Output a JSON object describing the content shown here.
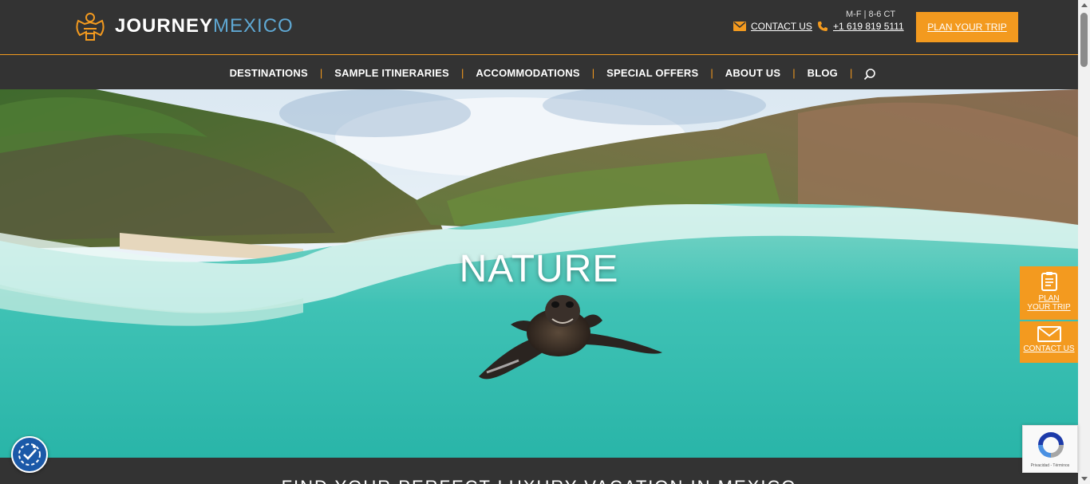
{
  "header": {
    "logo_bold": "JOURNEY",
    "logo_light": "MEXICO",
    "contact_label": "CONTACT US",
    "hours": "M-F | 8-6 CT",
    "phone": "+1 619 819 5111",
    "plan_button": "PLAN YOUR TRIP"
  },
  "nav": {
    "items": [
      "DESTINATIONS",
      "SAMPLE ITINERARIES",
      "ACCOMMODATIONS",
      "SPECIAL OFFERS",
      "ABOUT US",
      "BLOG"
    ],
    "separator": "|"
  },
  "hero": {
    "title": "NATURE"
  },
  "below": {
    "heading": "FIND YOUR PERFECT LUXURY VACATION IN MEXICO"
  },
  "side_tabs": {
    "plan_line1": "PLAN",
    "plan_line2": "YOUR TRIP",
    "contact": "CONTACT US"
  },
  "recaptcha": {
    "text": "Privacidad - Términos"
  },
  "colors": {
    "accent": "#f39a1f",
    "dark": "#333333",
    "logo_light": "#5fa8d3",
    "a11y": "#1b59a8"
  },
  "icons": [
    "logo-eagle-icon",
    "mail-icon",
    "phone-icon",
    "search-icon",
    "clipboard-icon",
    "envelope-icon",
    "accessibility-icon",
    "recaptcha-icon"
  ]
}
